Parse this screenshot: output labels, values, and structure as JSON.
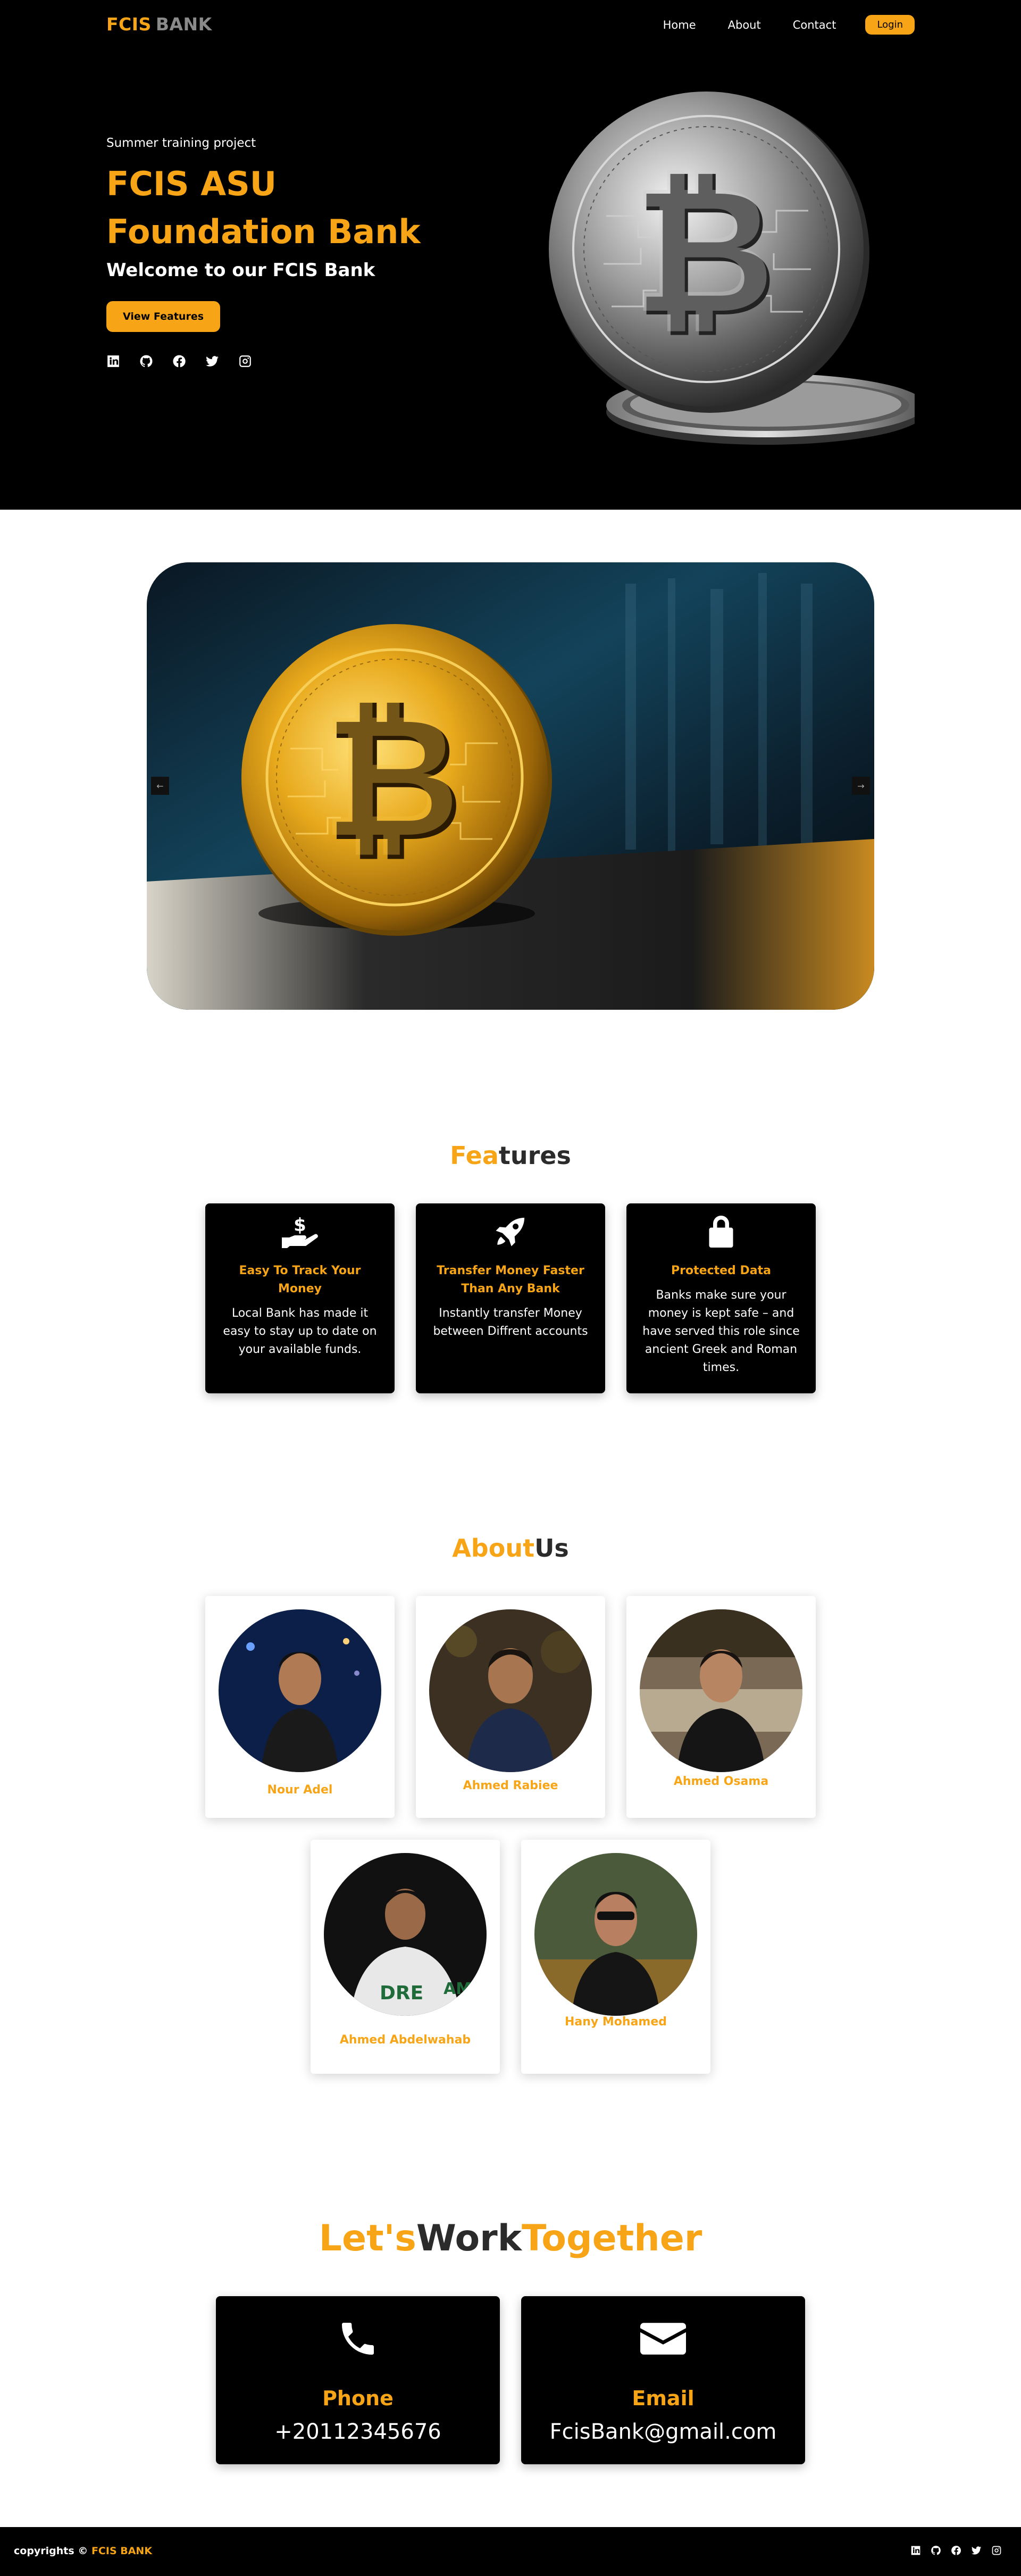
{
  "nav": {
    "brand_part1": "FCIS",
    "brand_part2": "BANK",
    "links": [
      "Home",
      "About",
      "Contact"
    ],
    "login_label": "Login"
  },
  "hero": {
    "subtitle": "Summer training project",
    "title": "FCIS ASU Foundation Bank",
    "welcome": "Welcome to our FCIS Bank",
    "button_label": "View Features",
    "social_icons": [
      "linkedin-icon",
      "github-icon",
      "facebook-icon",
      "twitter-icon",
      "instagram-icon"
    ]
  },
  "carousel": {
    "prev_label": "←",
    "next_label": "→"
  },
  "features": {
    "title_part1": "Fea",
    "title_part2": "tures",
    "cards": [
      {
        "icon": "hand-dollar-icon",
        "title": "Easy To Track Your Money",
        "text": "Local Bank has made it easy to stay up to date on your available funds."
      },
      {
        "icon": "rocket-icon",
        "title": "Transfer Money Faster Than Any Bank",
        "text": "Instantly transfer Money between Diffrent accounts"
      },
      {
        "icon": "lock-icon",
        "title": "Protected Data",
        "text": "Banks make sure your money is kept safe – and have served this role since ancient Greek and Roman times."
      }
    ]
  },
  "about": {
    "title_part1": "About",
    "title_part2": "Us",
    "members": [
      "Nour Adel",
      "Ahmed Rabiee",
      "Ahmed Osama",
      "Ahmed Abdelwahab",
      "Hany Mohamed"
    ]
  },
  "contact": {
    "title_part1": "Let's",
    "title_part2": "Work",
    "title_part3": "Together",
    "cards": [
      {
        "icon": "phone-icon",
        "label": "Phone",
        "value": "+20112345676"
      },
      {
        "icon": "envelope-icon",
        "label": "Email",
        "value": "FcisBank@gmail.com"
      }
    ]
  },
  "footer": {
    "copyright": "copyrights ©",
    "brand": "FCIS BANK"
  },
  "colors": {
    "accent": "#f7a516",
    "background_dark": "#000000",
    "heading_dark": "#2b2b2b"
  }
}
